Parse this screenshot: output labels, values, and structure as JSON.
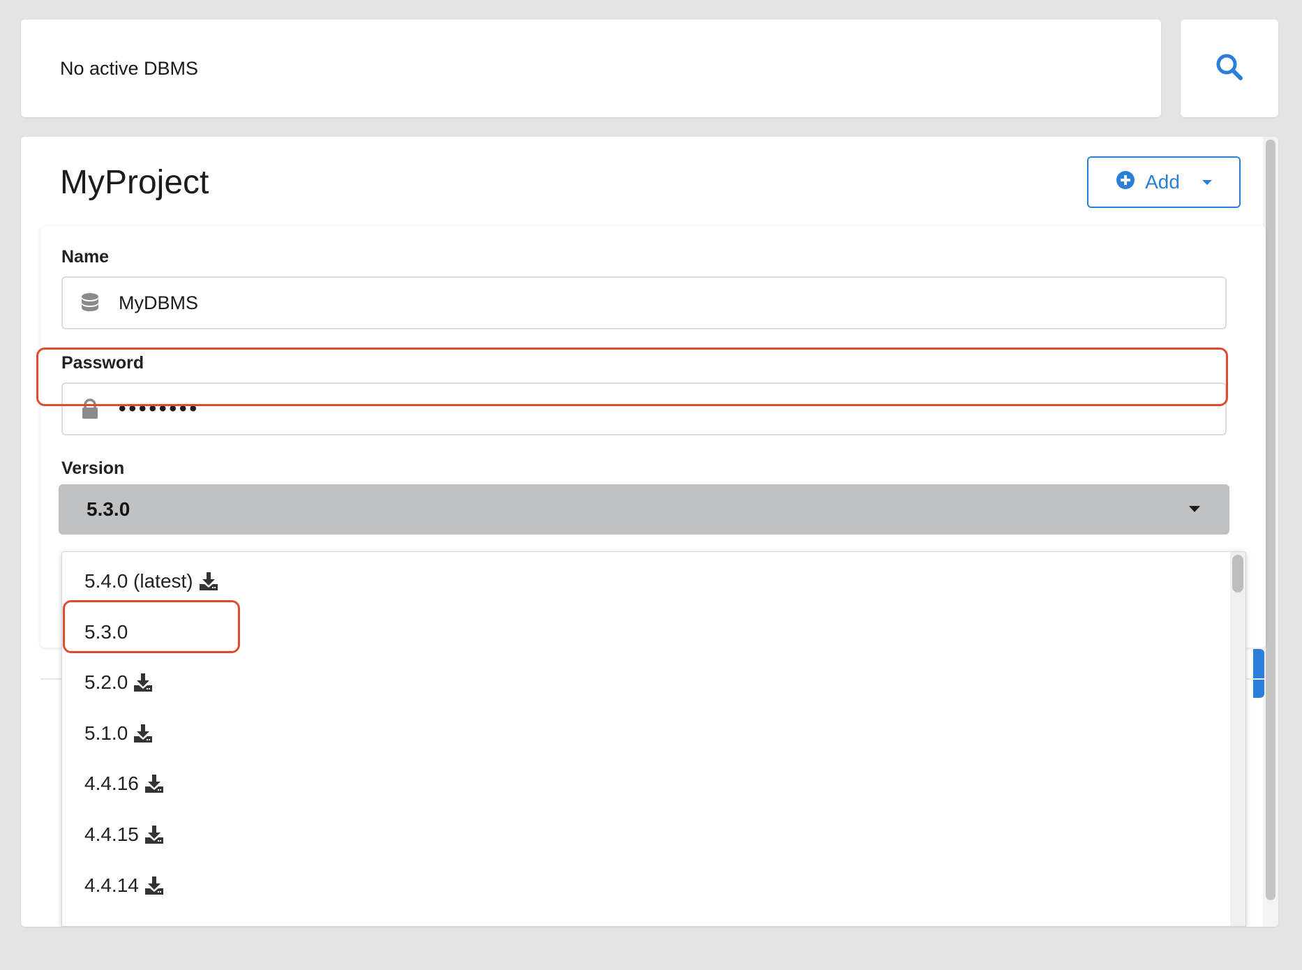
{
  "topbar": {
    "status_text": "No active DBMS"
  },
  "search": {
    "icon": "search-icon"
  },
  "project": {
    "title": "MyProject",
    "add_label": "Add"
  },
  "form": {
    "name_label": "Name",
    "name_value": "MyDBMS",
    "password_label": "Password",
    "password_value": "••••••••",
    "version_label": "Version",
    "version_selected": "5.3.0"
  },
  "version_options": [
    {
      "label": "5.4.0 (latest)",
      "download": true
    },
    {
      "label": "5.3.0",
      "download": false
    },
    {
      "label": "5.2.0",
      "download": true
    },
    {
      "label": "5.1.0",
      "download": true
    },
    {
      "label": "4.4.16",
      "download": true
    },
    {
      "label": "4.4.15",
      "download": true
    },
    {
      "label": "4.4.14",
      "download": true
    }
  ],
  "colors": {
    "accent": "#2b7fd8",
    "highlight": "#e04a2e",
    "select_bg": "#c0c1c3"
  }
}
